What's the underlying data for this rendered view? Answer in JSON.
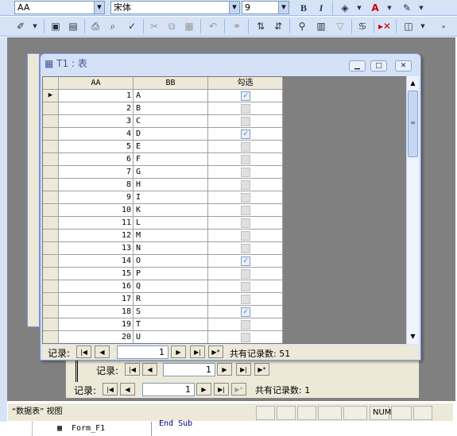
{
  "toolbar1": {
    "object_combo": "AA",
    "font_combo": "宋体",
    "size_combo": "9",
    "bold": "B",
    "italic": "I"
  },
  "toolbar2": {},
  "window": {
    "title": "T1 : 表"
  },
  "grid": {
    "columns": [
      "AA",
      "BB",
      "勾选"
    ],
    "rows": [
      {
        "aa": "1",
        "bb": "A",
        "checked": true
      },
      {
        "aa": "2",
        "bb": "B",
        "checked": false
      },
      {
        "aa": "3",
        "bb": "C",
        "checked": false
      },
      {
        "aa": "4",
        "bb": "D",
        "checked": true
      },
      {
        "aa": "5",
        "bb": "E",
        "checked": false
      },
      {
        "aa": "6",
        "bb": "F",
        "checked": false
      },
      {
        "aa": "7",
        "bb": "G",
        "checked": false
      },
      {
        "aa": "8",
        "bb": "H",
        "checked": false
      },
      {
        "aa": "9",
        "bb": "I",
        "checked": false
      },
      {
        "aa": "10",
        "bb": "K",
        "checked": false
      },
      {
        "aa": "11",
        "bb": "L",
        "checked": false
      },
      {
        "aa": "12",
        "bb": "M",
        "checked": false
      },
      {
        "aa": "13",
        "bb": "N",
        "checked": false
      },
      {
        "aa": "14",
        "bb": "O",
        "checked": true
      },
      {
        "aa": "15",
        "bb": "P",
        "checked": false
      },
      {
        "aa": "16",
        "bb": "Q",
        "checked": false
      },
      {
        "aa": "17",
        "bb": "R",
        "checked": false
      },
      {
        "aa": "18",
        "bb": "S",
        "checked": true
      },
      {
        "aa": "19",
        "bb": "T",
        "checked": false
      },
      {
        "aa": "20",
        "bb": "U",
        "checked": false
      }
    ]
  },
  "nav_main": {
    "label": "记录:",
    "current": "1",
    "total_label": "共有记录数: 51"
  },
  "nav_sub": {
    "label": "记录:",
    "current": "1"
  },
  "nav_form": {
    "label": "记录:",
    "current": "1",
    "total_label": "共有记录数: 1"
  },
  "status": {
    "view": "“数据表” 视图",
    "num": "NUM"
  },
  "code": {
    "end_sub": "End Sub",
    "tree_item": "Form_F1"
  }
}
